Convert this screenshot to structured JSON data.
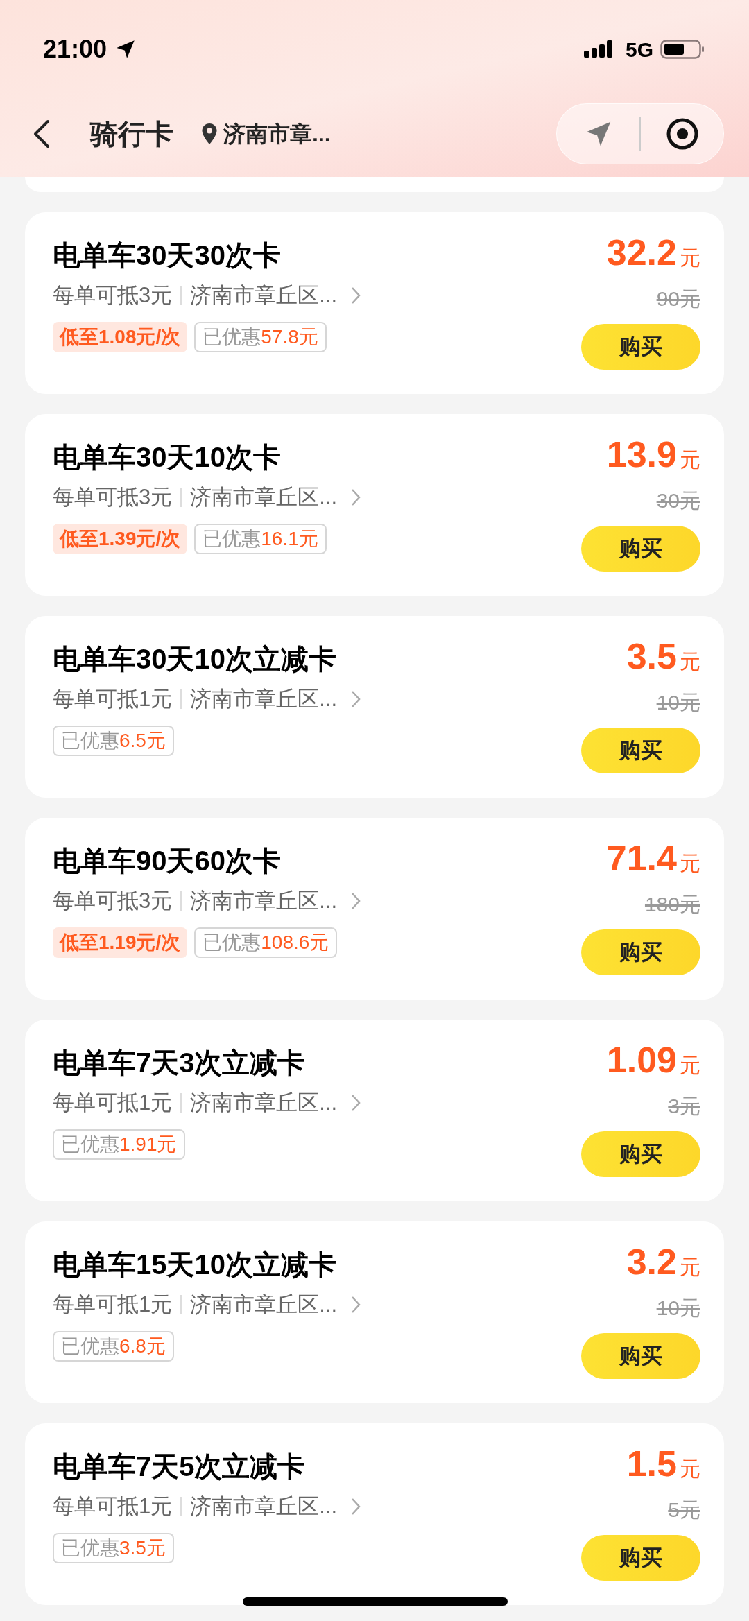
{
  "status_bar": {
    "time": "21:00",
    "network": "5G"
  },
  "nav": {
    "title": "骑行卡",
    "location": "济南市章..."
  },
  "cards": [
    {
      "title": "电单车30天30次卡",
      "deduction": "每单可抵3元",
      "area": "济南市章丘区...",
      "per_ride": "低至1.08元/次",
      "saved_label": "已优惠",
      "saved_amount": "57.8元",
      "price": "32.2",
      "price_unit": "元",
      "original_price": "90元",
      "button": "购买"
    },
    {
      "title": "电单车30天10次卡",
      "deduction": "每单可抵3元",
      "area": "济南市章丘区...",
      "per_ride": "低至1.39元/次",
      "saved_label": "已优惠",
      "saved_amount": "16.1元",
      "price": "13.9",
      "price_unit": "元",
      "original_price": "30元",
      "button": "购买"
    },
    {
      "title": "电单车30天10次立减卡",
      "deduction": "每单可抵1元",
      "area": "济南市章丘区...",
      "saved_label": "已优惠",
      "saved_amount": "6.5元",
      "price": "3.5",
      "price_unit": "元",
      "original_price": "10元",
      "button": "购买"
    },
    {
      "title": "电单车90天60次卡",
      "deduction": "每单可抵3元",
      "area": "济南市章丘区...",
      "per_ride": "低至1.19元/次",
      "saved_label": "已优惠",
      "saved_amount": "108.6元",
      "price": "71.4",
      "price_unit": "元",
      "original_price": "180元",
      "button": "购买"
    },
    {
      "title": "电单车7天3次立减卡",
      "deduction": "每单可抵1元",
      "area": "济南市章丘区...",
      "saved_label": "已优惠",
      "saved_amount": "1.91元",
      "price": "1.09",
      "price_unit": "元",
      "original_price": "3元",
      "button": "购买"
    },
    {
      "title": "电单车15天10次立减卡",
      "deduction": "每单可抵1元",
      "area": "济南市章丘区...",
      "saved_label": "已优惠",
      "saved_amount": "6.8元",
      "price": "3.2",
      "price_unit": "元",
      "original_price": "10元",
      "button": "购买"
    },
    {
      "title": "电单车7天5次立减卡",
      "deduction": "每单可抵1元",
      "area": "济南市章丘区...",
      "saved_label": "已优惠",
      "saved_amount": "3.5元",
      "price": "1.5",
      "price_unit": "元",
      "original_price": "5元",
      "button": "购买"
    }
  ]
}
